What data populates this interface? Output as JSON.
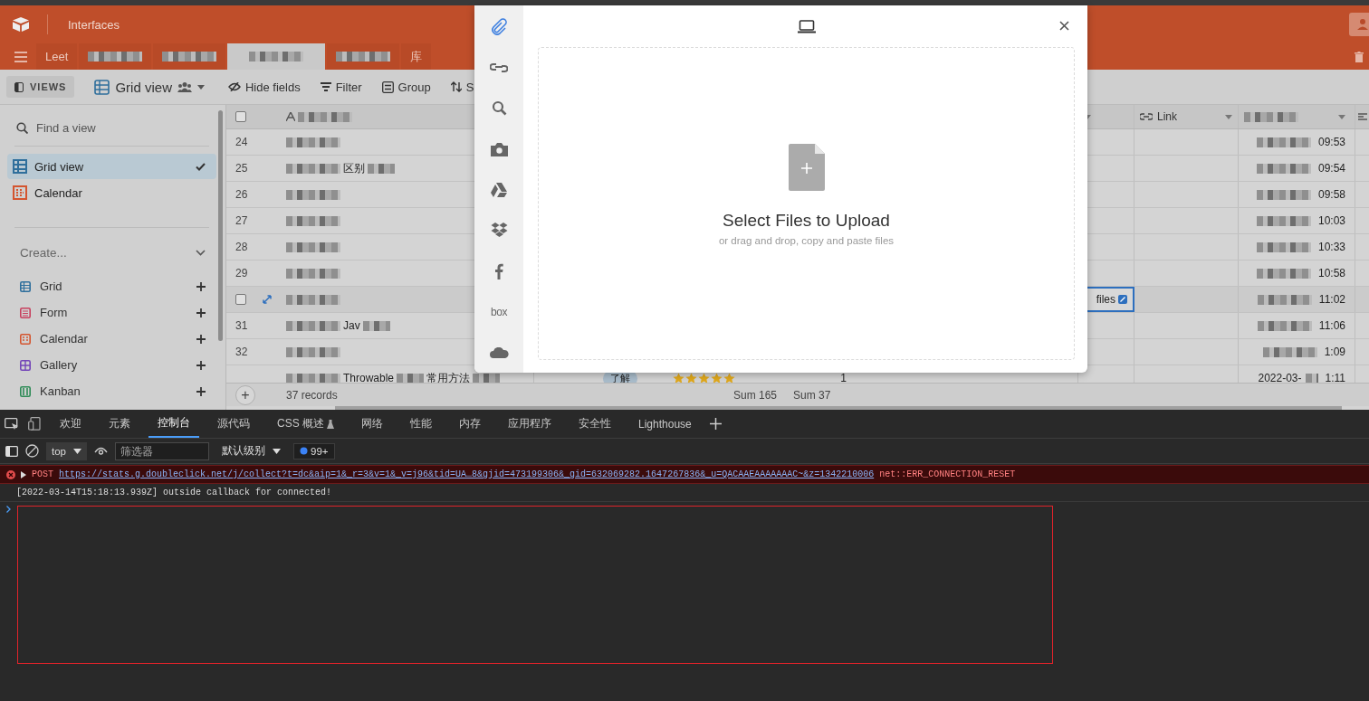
{
  "header": {
    "title": "Interfaces",
    "tabs": [
      {
        "label": "Leet",
        "selected": false
      },
      {
        "selected": false
      },
      {
        "selected": false
      },
      {
        "selected": true
      },
      {
        "selected": false
      },
      {
        "label": "库",
        "selected": false
      }
    ]
  },
  "toolbar": {
    "views_label": "VIEWS",
    "current_view": "Grid view",
    "buttons": [
      {
        "kind": "hide",
        "label": "Hide fields"
      },
      {
        "kind": "filter",
        "label": "Filter"
      },
      {
        "kind": "group",
        "label": "Group"
      },
      {
        "kind": "sort",
        "label": "S"
      }
    ]
  },
  "sidebar": {
    "search": {
      "placeholder": "Find a view"
    },
    "views": [
      {
        "kind": "grid",
        "label": "Grid view",
        "selected": true,
        "color": "#2f6f9c"
      },
      {
        "kind": "calendar",
        "label": "Calendar",
        "selected": false,
        "color": "#d4552f"
      }
    ],
    "create_label": "Create...",
    "create_items": [
      {
        "kind": "grid",
        "label": "Grid",
        "color": "#2f6f9c"
      },
      {
        "kind": "form",
        "label": "Form",
        "color": "#c8405e"
      },
      {
        "kind": "calendar",
        "label": "Calendar",
        "color": "#d4552f"
      },
      {
        "kind": "gallery",
        "label": "Gallery",
        "color": "#7446b8"
      },
      {
        "kind": "kanban",
        "label": "Kanban",
        "color": "#2e8b57"
      }
    ]
  },
  "grid": {
    "columns": [
      {
        "kind": "title"
      },
      {
        "kind": "attachment"
      },
      {
        "kind": "link",
        "label": "Link"
      },
      {
        "kind": "date"
      }
    ],
    "rows": [
      {
        "number": "24",
        "hovered": false,
        "time": "09:53"
      },
      {
        "number": "25",
        "hovered": false,
        "title_parts": [
          "区别"
        ],
        "time": "09:54"
      },
      {
        "number": "26",
        "hovered": false,
        "time": "09:58"
      },
      {
        "number": "27",
        "hovered": false,
        "time": "10:03"
      },
      {
        "number": "28",
        "hovered": false,
        "time": "10:33"
      },
      {
        "number": "29",
        "hovered": false,
        "time": "10:58"
      },
      {
        "hovered": true,
        "attachment_text": "files",
        "time": "11:02"
      },
      {
        "number": "31",
        "hovered": false,
        "title_parts": [
          "Jav"
        ],
        "time": "11:06"
      },
      {
        "number": "32",
        "hovered": false,
        "time": "1:09"
      },
      {
        "hovered": false,
        "title_parts": [
          "Throwable",
          "常用方法"
        ],
        "tag": "了解",
        "stars": 5,
        "count": "1",
        "date": "2022-03-",
        "time": "1:11"
      }
    ],
    "select_all": {
      "checked": false
    },
    "footer": {
      "add": "+",
      "records": "37 records",
      "sums": [
        "Sum 165",
        "Sum 37"
      ]
    }
  },
  "upload_dialog": {
    "sources": [
      {
        "kind": "paperclip",
        "selected": true
      },
      {
        "kind": "link",
        "selected": false
      },
      {
        "kind": "search",
        "selected": false
      },
      {
        "kind": "camera",
        "selected": false
      },
      {
        "kind": "drive",
        "selected": false
      },
      {
        "kind": "dropbox",
        "selected": false
      },
      {
        "kind": "facebook",
        "selected": false
      },
      {
        "kind": "text",
        "label": "box",
        "selected": false
      },
      {
        "kind": "cloud",
        "selected": false
      }
    ],
    "heading": "Select Files to Upload",
    "subtext": "or drag and drop, copy and paste files"
  },
  "devtools": {
    "tabs": [
      {
        "label": "欢迎",
        "selected": false
      },
      {
        "label": "元素",
        "selected": false
      },
      {
        "label": "控制台",
        "selected": true
      },
      {
        "label": "源代码",
        "selected": false
      },
      {
        "label": "CSS 概述",
        "selected": false,
        "experimental": true
      },
      {
        "label": "网络",
        "selected": false
      },
      {
        "label": "性能",
        "selected": false
      },
      {
        "label": "内存",
        "selected": false
      },
      {
        "label": "应用程序",
        "selected": false
      },
      {
        "label": "安全性",
        "selected": false
      },
      {
        "label": "Lighthouse",
        "selected": false
      }
    ],
    "context": "top",
    "filter": {
      "placeholder": "筛选器"
    },
    "level": "默认级别",
    "badge": "99+",
    "messages": [
      {
        "kind": "error",
        "method": "POST",
        "url": "https://stats.g.doubleclick.net/j/collect?t=dc&aip=1&_r=3&v=1&_v=j96&tid=UA…8&gjid=473199306&_gid=632069282.1647267836&_u=QACAAEAAAAAAAC~&z=1342210006",
        "message": "net::ERR_CONNECTION_RESET"
      },
      {
        "kind": "log",
        "text": "[2022-03-14T15:18:13.939Z] outside callback for connected!"
      }
    ]
  }
}
